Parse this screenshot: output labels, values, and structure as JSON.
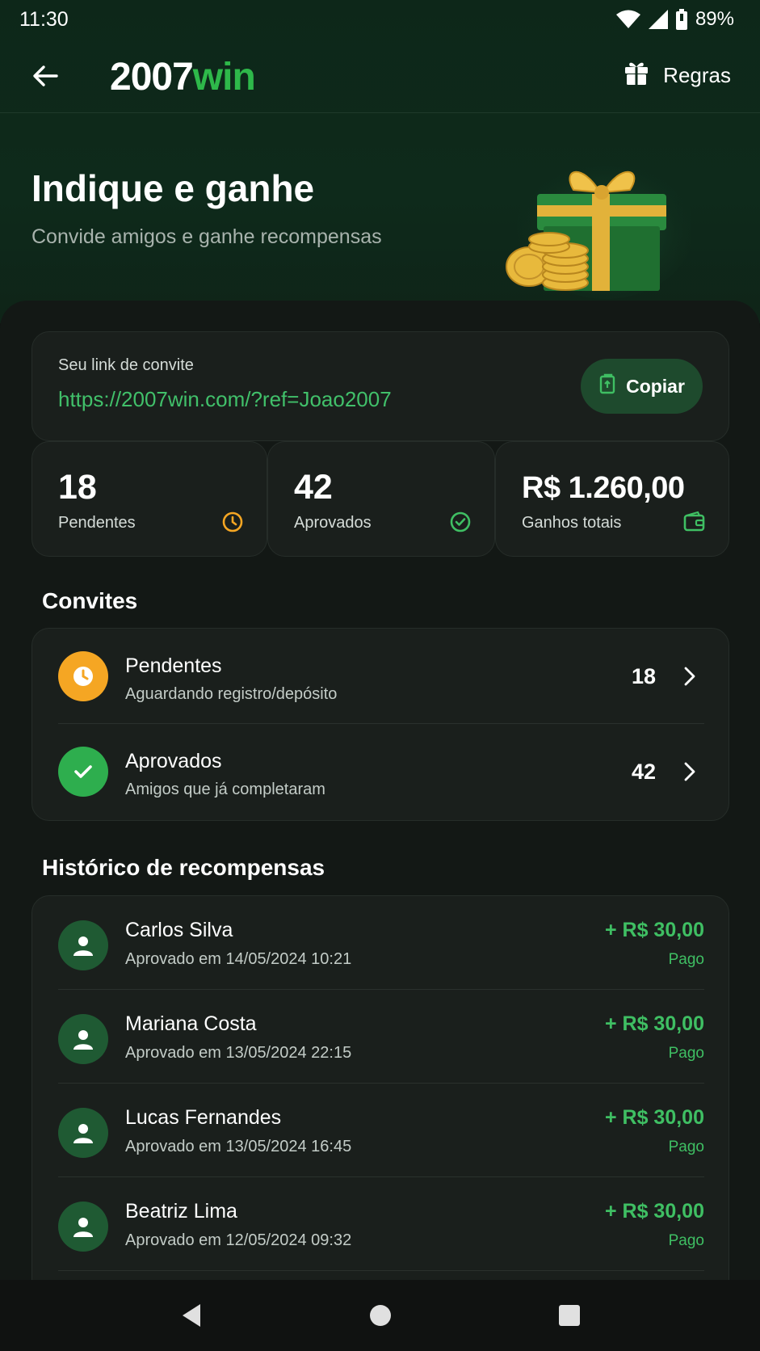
{
  "status_bar": {
    "time": "11:30",
    "battery": "89%"
  },
  "header": {
    "logo_part1": "2007",
    "logo_part2": "win",
    "rules_label": "Regras"
  },
  "hero": {
    "title": "Indique e ganhe",
    "subtitle": "Convide amigos e ganhe recompensas"
  },
  "invite": {
    "label": "Seu link de convite",
    "link": "https://2007win.com/?ref=Joao2007",
    "copy_label": "Copiar"
  },
  "stats": [
    {
      "value": "18",
      "label": "Pendentes",
      "icon": "clock-icon"
    },
    {
      "value": "42",
      "label": "Aprovados",
      "icon": "check-circle-icon"
    },
    {
      "value": "R$ 1.260,00",
      "label": "Ganhos totais",
      "icon": "wallet-icon"
    }
  ],
  "invites_section": {
    "title": "Convites",
    "rows": [
      {
        "title": "Pendentes",
        "subtitle": "Aguardando registro/depósito",
        "count": "18"
      },
      {
        "title": "Aprovados",
        "subtitle": "Amigos que já completaram",
        "count": "42"
      }
    ]
  },
  "history_section": {
    "title": "Histórico de recompensas",
    "rows": [
      {
        "name": "Carlos Silva",
        "date": "Aprovado em 14/05/2024 10:21",
        "amount": "+ R$ 30,00",
        "status": "Pago"
      },
      {
        "name": "Mariana Costa",
        "date": "Aprovado em 13/05/2024 22:15",
        "amount": "+ R$ 30,00",
        "status": "Pago"
      },
      {
        "name": "Lucas Fernandes",
        "date": "Aprovado em 13/05/2024 16:45",
        "amount": "+ R$ 30,00",
        "status": "Pago"
      },
      {
        "name": "Beatriz Lima",
        "date": "Aprovado em 12/05/2024 09:32",
        "amount": "+ R$ 30,00",
        "status": "Pago"
      }
    ]
  },
  "colors": {
    "accent": "#3fbf63",
    "pending": "#f5a623",
    "brand": "#2eb84a"
  }
}
